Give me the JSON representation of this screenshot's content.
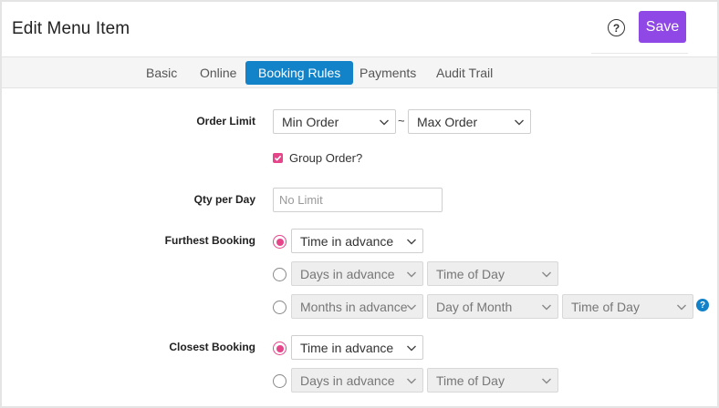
{
  "header": {
    "title": "Edit Menu Item",
    "help_icon": "question-circle-icon",
    "help_glyph": "?",
    "save_label": "Save"
  },
  "tabs": [
    {
      "label": "Basic",
      "active": false
    },
    {
      "label": "Online",
      "active": false
    },
    {
      "label": "Booking Rules",
      "active": true
    },
    {
      "label": "Payments",
      "active": false
    },
    {
      "label": "Audit Trail",
      "active": false
    }
  ],
  "order_limit": {
    "label": "Order Limit",
    "min": "Min Order",
    "separator": "~",
    "max": "Max Order"
  },
  "group_order": {
    "label": "Group Order?",
    "checked": true
  },
  "qty_per_day": {
    "label": "Qty per Day",
    "placeholder": "No Limit",
    "value": ""
  },
  "furthest_booking": {
    "label": "Furthest Booking",
    "options": [
      {
        "selected": true,
        "fields": [
          "Time in advance"
        ]
      },
      {
        "selected": false,
        "fields": [
          "Days in advance",
          "Time of Day"
        ]
      },
      {
        "selected": false,
        "fields": [
          "Months in advance",
          "Day of Month",
          "Time of Day"
        ]
      }
    ],
    "info_glyph": "?"
  },
  "closest_booking": {
    "label": "Closest Booking",
    "options": [
      {
        "selected": true,
        "fields": [
          "Time in advance"
        ]
      },
      {
        "selected": false,
        "fields": [
          "Days in advance",
          "Time of Day"
        ]
      }
    ]
  },
  "colors": {
    "accent_purple": "#8f47e6",
    "tab_active_blue": "#1282c9",
    "pink": "#e6458a"
  }
}
